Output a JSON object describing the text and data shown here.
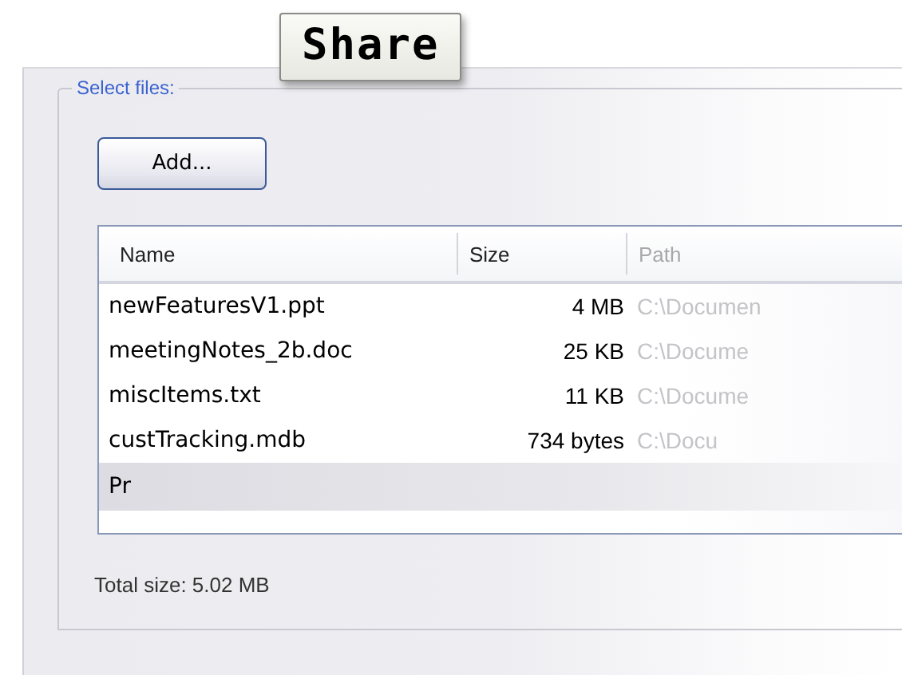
{
  "tooltip": {
    "text": "Share"
  },
  "group": {
    "title": "Select files:"
  },
  "add_button": {
    "label": "Add..."
  },
  "table": {
    "columns": [
      "Name",
      "Size",
      "Path"
    ],
    "rows": [
      {
        "name": "newFeaturesV1.ppt",
        "size": "4 MB",
        "path": "C:\\Documen"
      },
      {
        "name": "meetingNotes_2b.doc",
        "size": "25 KB",
        "path": "C:\\Docume"
      },
      {
        "name": "miscItems.txt",
        "size": "11 KB",
        "path": "C:\\Docume"
      },
      {
        "name": "custTracking.mdb",
        "size": "734 bytes",
        "path": "C:\\Docu"
      }
    ],
    "new_entry": {
      "value": "Pr"
    }
  },
  "total": "Total size: 5.02 MB"
}
